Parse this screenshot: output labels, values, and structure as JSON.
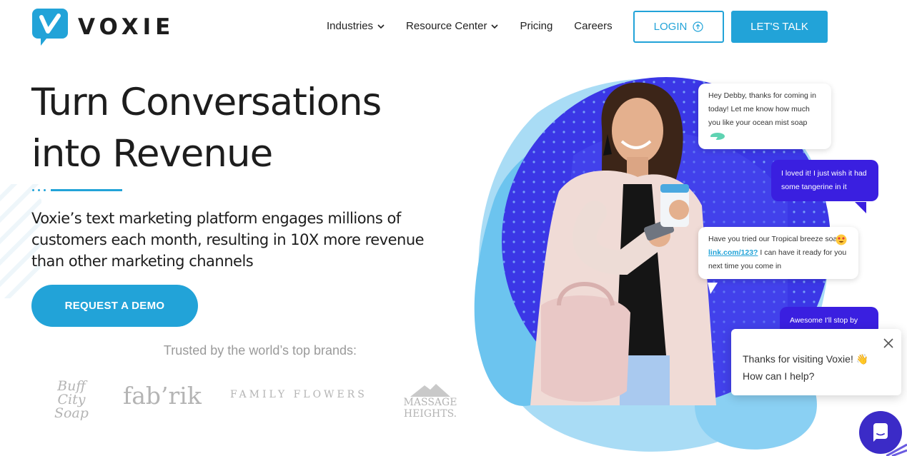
{
  "brand": {
    "name": "VOXIE",
    "accent": "#22a3d8",
    "purple": "#3a1fe0"
  },
  "nav": {
    "items": [
      {
        "label": "Industries",
        "dropdown": true
      },
      {
        "label": "Resource Center",
        "dropdown": true
      },
      {
        "label": "Pricing",
        "dropdown": false
      },
      {
        "label": "Careers",
        "dropdown": false
      }
    ],
    "login_label": "LOGIN",
    "talk_label": "LET'S TALK"
  },
  "hero": {
    "title_line1": "Turn Conversations",
    "title_line2": "into Revenue",
    "subtitle": "Voxie’s text marketing platform engages millions of customers each month, resulting in 10X more revenue than other marketing channels",
    "cta_label": "REQUEST A DEMO",
    "trusted_label": "Trusted by the world’s top brands:"
  },
  "brands": {
    "buff_line1": "Buff City",
    "buff_line2": "Soap",
    "fabrik": "fab’rik",
    "family_flowers": "FAMILY FLOWERS",
    "massage_heights": "MASSAGE HEIGHTS."
  },
  "bubbles": {
    "b1": "Hey Debby, thanks for coming in today!  Let me know how much you like your ocean mist soap",
    "b2": "I loved it! I just wish it had some tangerine in it",
    "b3_pre": "Have you tried our Tropical breeze soap ",
    "b3_link": "link.com/123?",
    "b3_post": " I can have it ready for you next time you come in",
    "b4": "Awesome  I'll stop by"
  },
  "chat": {
    "line1": "Thanks for visiting Voxie! 👋",
    "line2": "How can I help?"
  },
  "icons": [
    "chevron-down-icon",
    "login-arrow-icon",
    "close-icon",
    "chat-icon",
    "soap-icon",
    "heart-eyes-icon"
  ]
}
